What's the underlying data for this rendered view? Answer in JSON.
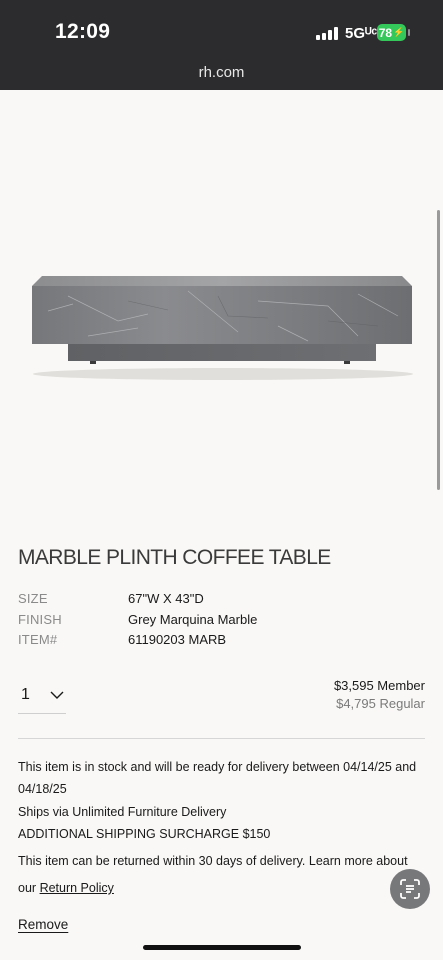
{
  "status_bar": {
    "time": "12:09",
    "network": "5Gᵁᶜ",
    "battery": "78",
    "url": "rh.com"
  },
  "product": {
    "title": "MARBLE PLINTH COFFEE TABLE",
    "specs": [
      {
        "label": "SIZE",
        "value": "67\"W X 43\"D"
      },
      {
        "label": "FINISH",
        "value": "Grey Marquina Marble"
      },
      {
        "label": "ITEM#",
        "value": "61190203 MARB"
      }
    ],
    "quantity": "1",
    "price_member": "$3,595 Member",
    "price_regular": "$4,795 Regular"
  },
  "delivery": {
    "stock_line1": "This item is in stock and will be ready for delivery between 04/14/25 and",
    "stock_line2": "04/18/25",
    "ships_via": "Ships via Unlimited Furniture Delivery",
    "surcharge": "ADDITIONAL SHIPPING SURCHARGE $150",
    "return_line1": "This item can be returned within 30 days of delivery. Learn more about",
    "return_prefix": "our",
    "return_link": "Return Policy"
  },
  "actions": {
    "remove": "Remove"
  },
  "icons": {
    "quantity_dropdown": "chevron-down-icon",
    "floating_button": "scan-text-icon"
  },
  "colors": {
    "status_bar_bg": "#2c2c2e",
    "page_bg": "#f9f8f6",
    "battery": "#34c759"
  }
}
